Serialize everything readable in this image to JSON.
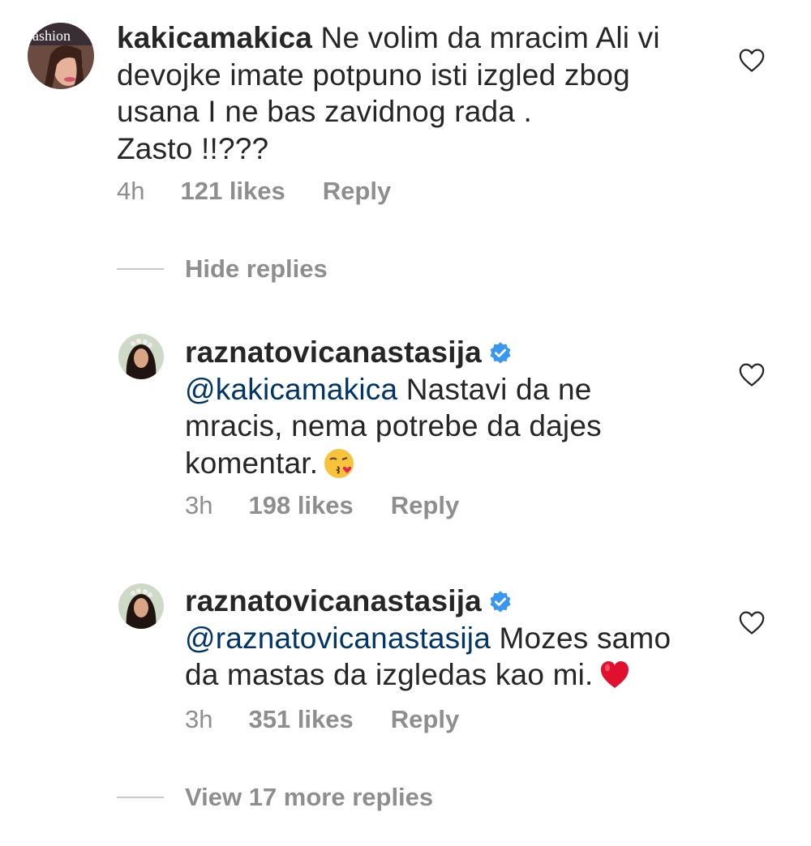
{
  "comment": {
    "username": "kakicamakica",
    "text_line1": "Ne volim da mracim Ali vi",
    "text_rest": "devojke imate potpuno isti izgled  zbog\nusana I ne bas zavidnog rada .\nZasto !!???",
    "time": "4h",
    "likes": "121 likes",
    "reply": "Reply",
    "avatar_text": "ashion"
  },
  "hide_replies": "Hide replies",
  "replies": [
    {
      "username": "raznatovicanastasija",
      "mention": "@kakicamakica",
      "text_line1": " Nastavi da ne",
      "text_rest": "mracis, nema potrebe da dajes\nkomentar.",
      "emoji": "kissing-face-emoji",
      "time": "3h",
      "likes": "198 likes",
      "reply": "Reply"
    },
    {
      "username": "raznatovicanastasija",
      "mention": "@raznatovicanastasija",
      "text_line1": " Mozes samo",
      "text_rest": "da mastas da izgledas kao mi.",
      "emoji": "red-heart-emoji",
      "time": "3h",
      "likes": "351 likes",
      "reply": "Reply"
    }
  ],
  "view_more": "View 17 more replies",
  "colors": {
    "mention": "#003569",
    "meta": "#8e8e8e",
    "verified": "#3897f0"
  }
}
